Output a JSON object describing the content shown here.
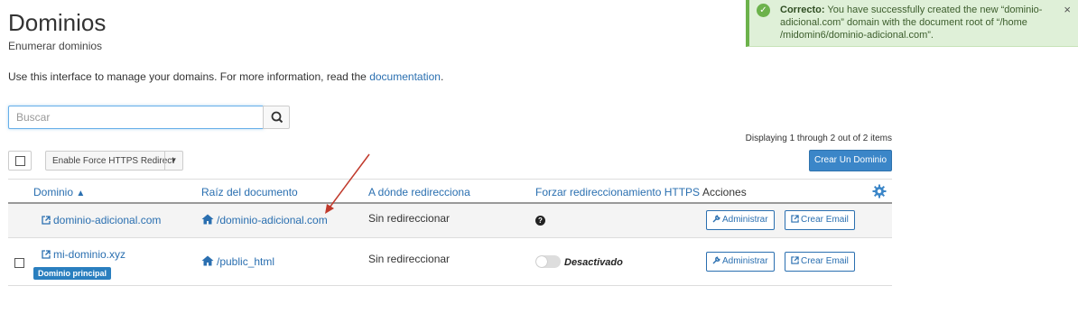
{
  "header": {
    "title": "Dominios",
    "subtitle": "Enumerar dominios"
  },
  "alert": {
    "strong": "Correcto:",
    "message": " You have successfully created the new “dominio-adicional.com” domain with the document root of “/home /midomin6/dominio-adicional.com”.",
    "close_label": "×",
    "type": "success",
    "color": "#dff0d8"
  },
  "intro": {
    "text": "Use this interface to manage your domains. For more information, read the ",
    "link": "documentation",
    "suffix": "."
  },
  "search": {
    "placeholder": "Buscar",
    "value": ""
  },
  "toolbar": {
    "https_redirect_label": "Enable Force HTTPS Redirect",
    "displaying": "Displaying 1 through 2 out of 2 items",
    "create_label": "Crear Un Dominio"
  },
  "table": {
    "columns": {
      "domain": "Dominio",
      "docroot": "Raíz del documento",
      "redirect": "A dónde redirecciona",
      "https": "Forzar redireccionamiento HTTPS",
      "actions": "Acciones"
    },
    "rows": [
      {
        "domain": "dominio-adicional.com",
        "docroot": "/dominio-adicional.com",
        "redirect": "Sin redireccionar",
        "https": "?",
        "manage": "Administrar",
        "email": "Crear Email"
      },
      {
        "domain": "mi-dominio.xyz",
        "badge": "Dominio principal",
        "docroot": "/public_html",
        "redirect": "Sin redireccionar",
        "https": "Desactivado",
        "https_enabled": false,
        "manage": "Administrar",
        "email": "Crear Email"
      }
    ]
  },
  "colors": {
    "accent": "#2a6fb0",
    "primary_button": "#3b86c8",
    "success": "#6cb24b",
    "annotation_arrow": "#c0392b"
  }
}
